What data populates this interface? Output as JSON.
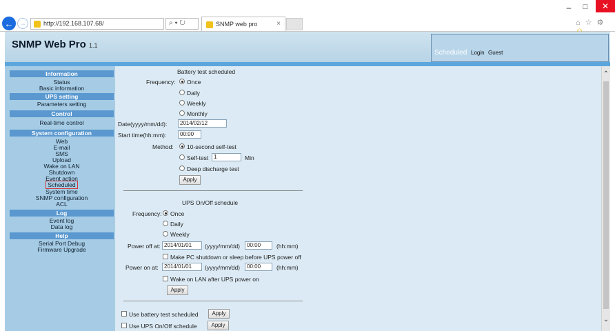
{
  "browser": {
    "url": "http://192.168.107.68/",
    "search_control": "⌕ ▾ ↻",
    "tab_title": "SNMP web pro",
    "tab_close": "×",
    "back_icon": "←",
    "forward_icon": "→",
    "window_minimize": "–",
    "window_maximize": "□",
    "window_close": "✕",
    "toolbar_icons": "⌂ ☆ ⚙",
    "toolbar_smiley": "☺"
  },
  "header": {
    "title": "SNMP Web Pro",
    "version": "1.1",
    "current_page": "Scheduled",
    "login": "Login",
    "user": "Guest"
  },
  "sidebar": {
    "sections": [
      {
        "title": "Information",
        "items": [
          "Status",
          "Basic information"
        ]
      },
      {
        "title": "UPS setting",
        "items": [
          "Parameters setting"
        ]
      },
      {
        "title": "Control",
        "items": [
          "Real-time control"
        ]
      },
      {
        "title": "System configuration",
        "items": [
          "Web",
          "E-mail",
          "SMS",
          "Upload",
          "Wake on LAN",
          "Shutdown",
          "Event action",
          "Scheduled",
          "System time",
          "SNMP configuration",
          "ACL"
        ]
      },
      {
        "title": "Log",
        "items": [
          "Event log",
          "Data log"
        ]
      },
      {
        "title": "Help",
        "items": [
          "Serial Port Debug",
          "Firmware Upgrade"
        ]
      }
    ],
    "active_item": "Scheduled"
  },
  "battery_test": {
    "title": "Battery test scheduled",
    "frequency_label": "Frequency:",
    "frequency_options": [
      "Once",
      "Daily",
      "Weekly",
      "Monthly"
    ],
    "frequency_selected": "Once",
    "date_label": "Date(yyyy/mm/dd):",
    "date_value": "2014/02/12",
    "start_time_label": "Start time(hh:mm):",
    "start_time_value": "00:00",
    "method_label": "Method:",
    "method_options": [
      "10-second self-test",
      "Self-test",
      "Deep discharge test"
    ],
    "method_selected": "10-second self-test",
    "self_test_minutes": "1",
    "self_test_unit": "Min",
    "apply_label": "Apply"
  },
  "ups_onoff": {
    "title": "UPS On/Off schedule",
    "frequency_label": "Frequency:",
    "frequency_options": [
      "Once",
      "Daily",
      "Weekly"
    ],
    "frequency_selected": "Once",
    "power_off_label": "Power off at:",
    "power_off_date": "2014/01/01",
    "power_off_time": "00:00",
    "date_format": "(yyyy/mm/dd)",
    "time_format": "(hh:mm)",
    "shutdown_pc_label": "Make PC shutdown or sleep before UPS power off",
    "power_on_label": "Power on at:",
    "power_on_date": "2014/01/01",
    "power_on_time": "00:00",
    "wake_on_lan_label": "Wake on LAN after UPS power on",
    "apply_label": "Apply"
  },
  "enable": {
    "use_battery_label": "Use battery test scheduled",
    "use_ups_label": "Use UPS On/Off schedule",
    "apply_label": "Apply"
  }
}
